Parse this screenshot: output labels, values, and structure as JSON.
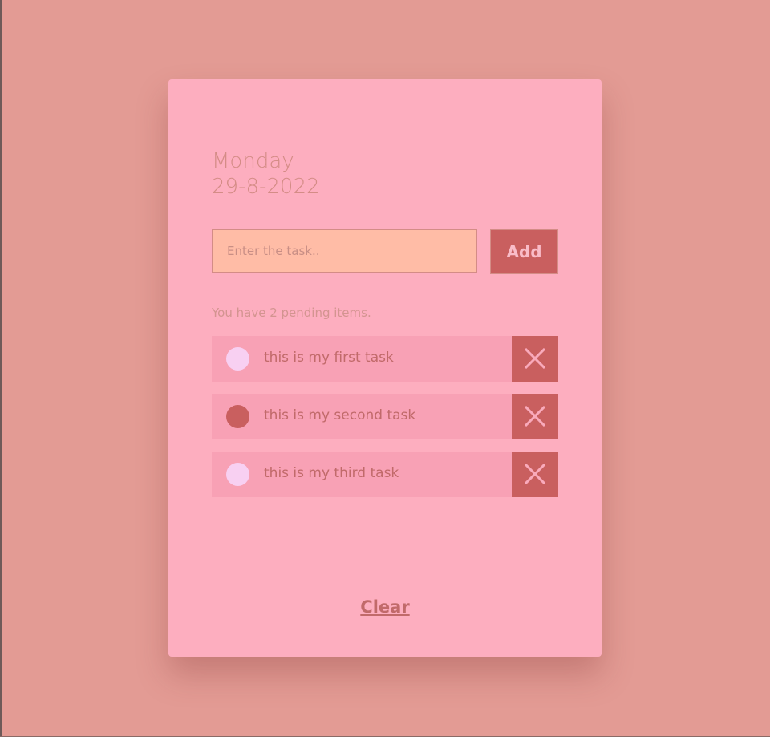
{
  "header": {
    "day": "Monday",
    "date": "29-8-2022"
  },
  "form": {
    "input_value": "",
    "input_placeholder": "Enter the task..",
    "add_label": "Add"
  },
  "status": {
    "pending_text": "You have 2 pending items."
  },
  "tasks": [
    {
      "text": "this is my first task",
      "done": false
    },
    {
      "text": "this is my second task",
      "done": true
    },
    {
      "text": "this is my third task",
      "done": false
    }
  ],
  "footer": {
    "clear_label": "Clear"
  },
  "icons": {
    "delete": "close-icon"
  },
  "colors": {
    "background": "#e39b94",
    "card": "#fdaebf",
    "accent": "#c95f5f",
    "input": "#ffbca6",
    "task_row": "#f8a1b5",
    "check_empty": "#f8d0f2",
    "muted_text": "#d48c86"
  }
}
